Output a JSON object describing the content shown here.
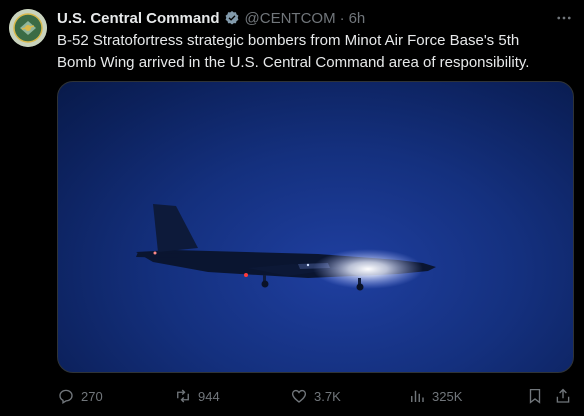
{
  "author": {
    "name": "U.S. Central Command",
    "handle": "@CENTCOM",
    "separator": "·",
    "time": "6h"
  },
  "post": {
    "text": "B-52 Stratofortress strategic bombers from Minot Air Force Base's 5th Bomb Wing arrived in the U.S. Central Command area of responsibility."
  },
  "actions": {
    "replies": "270",
    "reposts": "944",
    "likes": "3.7K",
    "views": "325K"
  },
  "colors": {
    "background": "#000000",
    "text_primary": "#e7e9ea",
    "text_secondary": "#71767b",
    "verified": "#829aab"
  },
  "icons": [
    "verified-badge-icon",
    "more-icon",
    "reply-icon",
    "repost-icon",
    "like-icon",
    "views-icon",
    "bookmark-icon",
    "share-icon"
  ]
}
